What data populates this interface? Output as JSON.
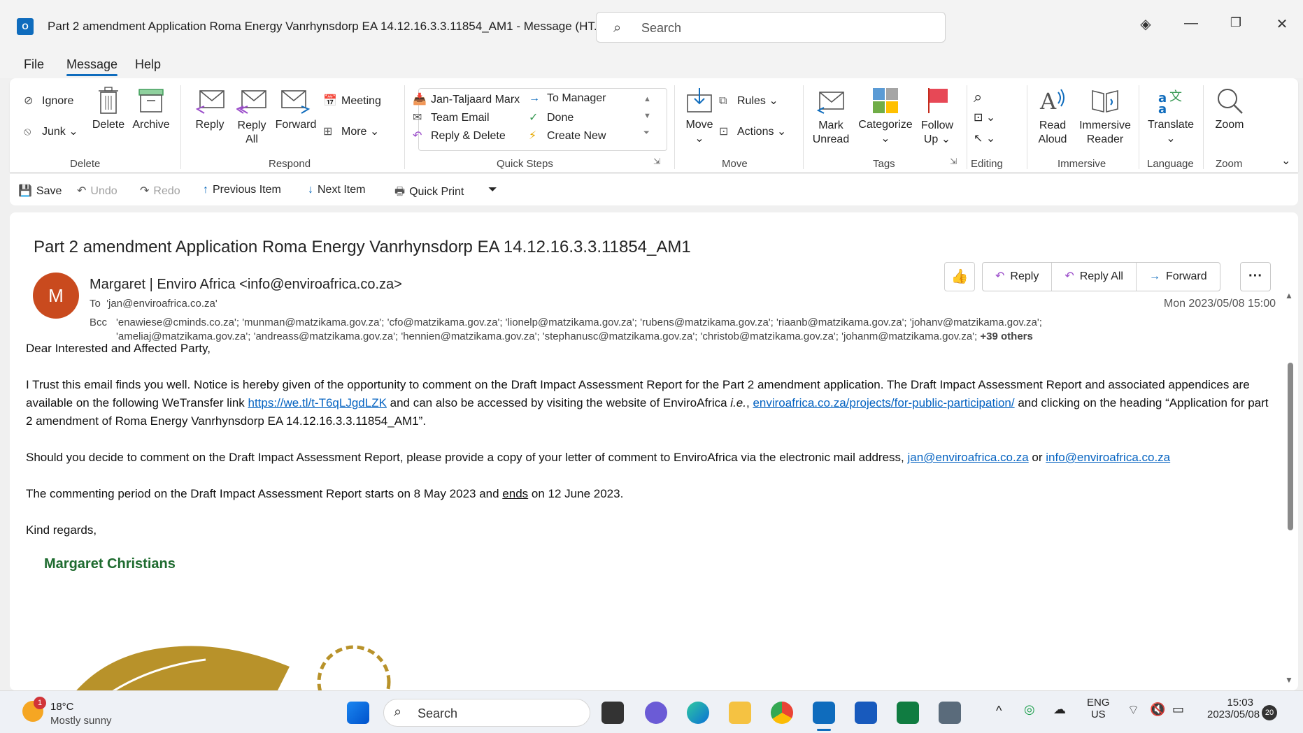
{
  "window": {
    "app_icon": "O",
    "title": "Part 2 amendment Application Roma Energy Vanrhynsdorp EA 14.12.16.3.3.11854_AM1  -  Message (HT...",
    "search_placeholder": "Search"
  },
  "menu": [
    "File",
    "Message",
    "Help"
  ],
  "ribbon": {
    "delete": {
      "ignore": "Ignore",
      "junk": "Junk",
      "delete": "Delete",
      "archive": "Archive",
      "label": "Delete"
    },
    "respond": {
      "reply": "Reply",
      "reply_all_1": "Reply",
      "reply_all_2": "All",
      "forward": "Forward",
      "meeting": "Meeting",
      "more": "More",
      "label": "Respond"
    },
    "quick_steps": {
      "items": [
        "Jan-Taljaard Marx",
        "To Manager",
        "Team Email",
        "Done",
        "Reply & Delete",
        "Create New"
      ],
      "label": "Quick Steps"
    },
    "move": {
      "move": "Move",
      "rules": "Rules",
      "actions": "Actions",
      "label": "Move"
    },
    "tags": {
      "mark_1": "Mark",
      "mark_2": "Unread",
      "categorize": "Categorize",
      "follow_1": "Follow",
      "follow_2": "Up",
      "label": "Tags"
    },
    "editing": {
      "label": "Editing"
    },
    "immersive": {
      "read_1": "Read",
      "read_2": "Aloud",
      "imm_1": "Immersive",
      "imm_2": "Reader",
      "label": "Immersive"
    },
    "language": {
      "translate": "Translate",
      "label": "Language"
    },
    "zoom": {
      "zoom": "Zoom",
      "label": "Zoom"
    }
  },
  "qat": {
    "save": "Save",
    "undo": "Undo",
    "redo": "Redo",
    "previous": "Previous Item",
    "next": "Next Item",
    "print": "Quick Print"
  },
  "message": {
    "subject": "Part 2 amendment Application Roma Energy Vanrhynsdorp EA 14.12.16.3.3.11854_AM1",
    "avatar": "M",
    "sender": "Margaret | Enviro Africa <info@enviroafrica.co.za>",
    "to_label": "To",
    "to": "'jan@enviroafrica.co.za'",
    "bcc_label": "Bcc",
    "bcc_line1": "'enawiese@cminds.co.za'; 'munman@matzikama.gov.za'; 'cfo@matzikama.gov.za'; 'lionelp@matzikama.gov.za'; 'rubens@matzikama.gov.za'; 'riaanb@matzikama.gov.za'; 'johanv@matzikama.gov.za';",
    "bcc_line2": "'ameliaj@matzikama.gov.za'; 'andreass@matzikama.gov.za'; 'hennien@matzikama.gov.za'; 'stephanusc@matzikama.gov.za'; 'christob@matzikama.gov.za'; 'johanm@matzikama.gov.za';",
    "bcc_more": "+39 others",
    "date": "Mon 2023/05/08 15:00",
    "actions": {
      "reply": "Reply",
      "reply_all": "Reply All",
      "forward": "Forward"
    },
    "greeting": "Dear Interested and Affected Party,",
    "p1_a": "I Trust this email finds you well.  Notice is hereby given of the opportunity to comment on the Draft Impact Assessment Report for the Part 2 amendment application. The Draft Impact Assessment Report and associated appendices are available on the following WeTransfer link ",
    "p1_link1": "https://we.tl/t-T6qLJgdLZK",
    "p1_b": " and can also be accessed by visiting the website of EnviroAfrica ",
    "p1_ie": "i.e.",
    "p1_c": ", ",
    "p1_link2": "enviroafrica.co.za/projects/for-public-participation/",
    "p1_d": " and clicking on the heading “Application for part 2 amendment of Roma Energy Vanrhynsdorp EA 14.12.16.3.3.11854_AM1”.",
    "p2_a": "Should you decide to comment on the Draft Impact Assessment Report, please provide a copy of your letter of comment to EnviroAfrica via the electronic mail address, ",
    "p2_link1": "jan@enviroafrica.co.za",
    "p2_or": " or ",
    "p2_link2": "info@enviroafrica.co.za",
    "p3_a": "The commenting period on the Draft Impact Assessment Report starts on 8 May 2023 and ",
    "p3_ends": "ends",
    "p3_b": " on 12 June 2023.",
    "closing": "Kind regards,",
    "signature": "Margaret Christians"
  },
  "taskbar": {
    "weather_badge": "1",
    "temp": "18°C",
    "condition": "Mostly sunny",
    "search": "Search",
    "lang_1": "ENG",
    "lang_2": "US",
    "time": "15:03",
    "date": "2023/05/08",
    "notif": "20"
  },
  "colors": {
    "accent": "#0f6cbd",
    "avatar": "#c94a1e",
    "link": "#0563c1",
    "signature": "#1e6b2f"
  }
}
